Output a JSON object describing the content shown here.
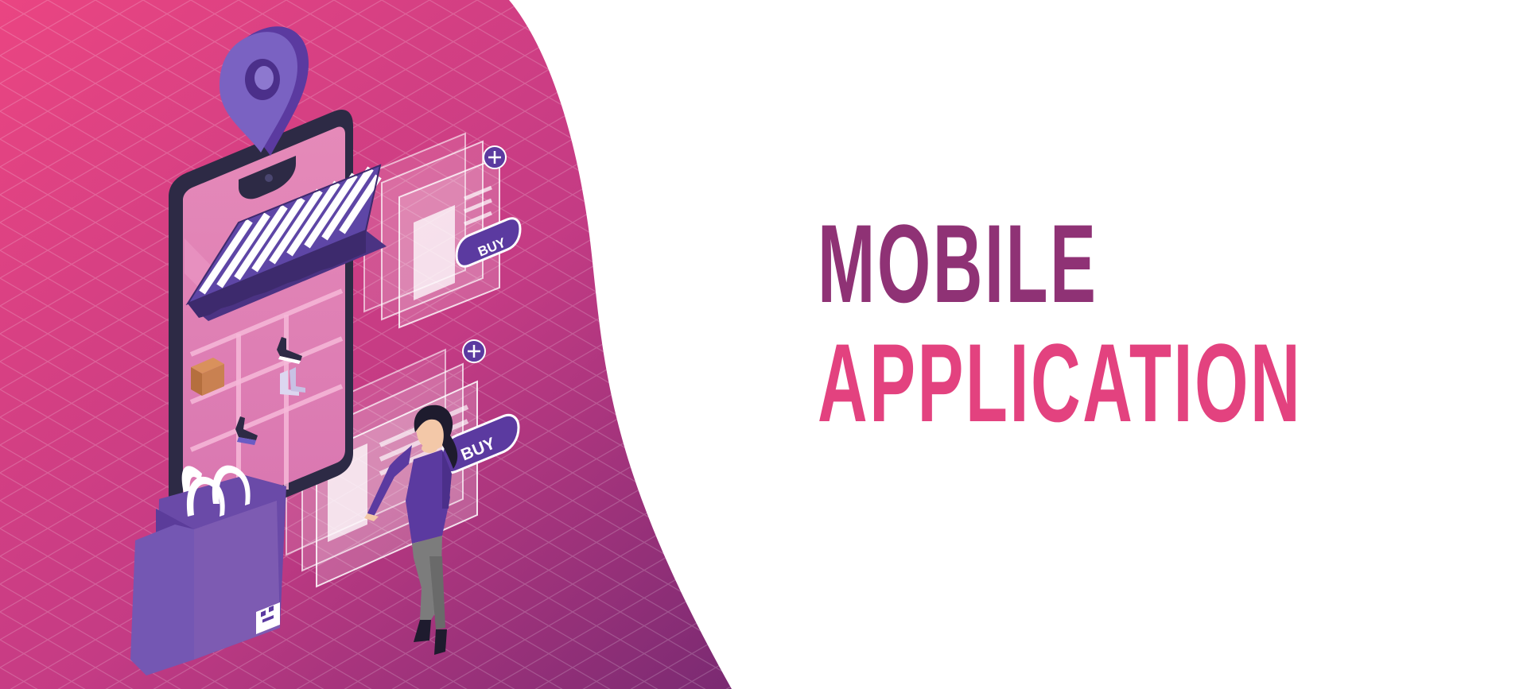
{
  "headline": {
    "line1": "MOBILE",
    "line2": "APPLICATION"
  },
  "cards": [
    {
      "button_label": "BUY",
      "add_icon": "plus-icon"
    },
    {
      "button_label": "BUY",
      "add_icon": "plus-icon"
    }
  ],
  "illustration": {
    "elements": [
      "location-pin-icon",
      "smartphone",
      "striped-awning",
      "product-shelf",
      "shopping-bag",
      "woman-shopper",
      "shoe-icon",
      "box-icon",
      "qr-code-icon"
    ]
  },
  "colors": {
    "background_gradient_start": "#e9447f",
    "background_gradient_end": "#7c2a73",
    "headline_line1": "#8f3275",
    "headline_line2": "#e3427f",
    "accent_purple": "#5b3aa0",
    "bag_purple": "#7d5bb2",
    "white": "#ffffff"
  }
}
